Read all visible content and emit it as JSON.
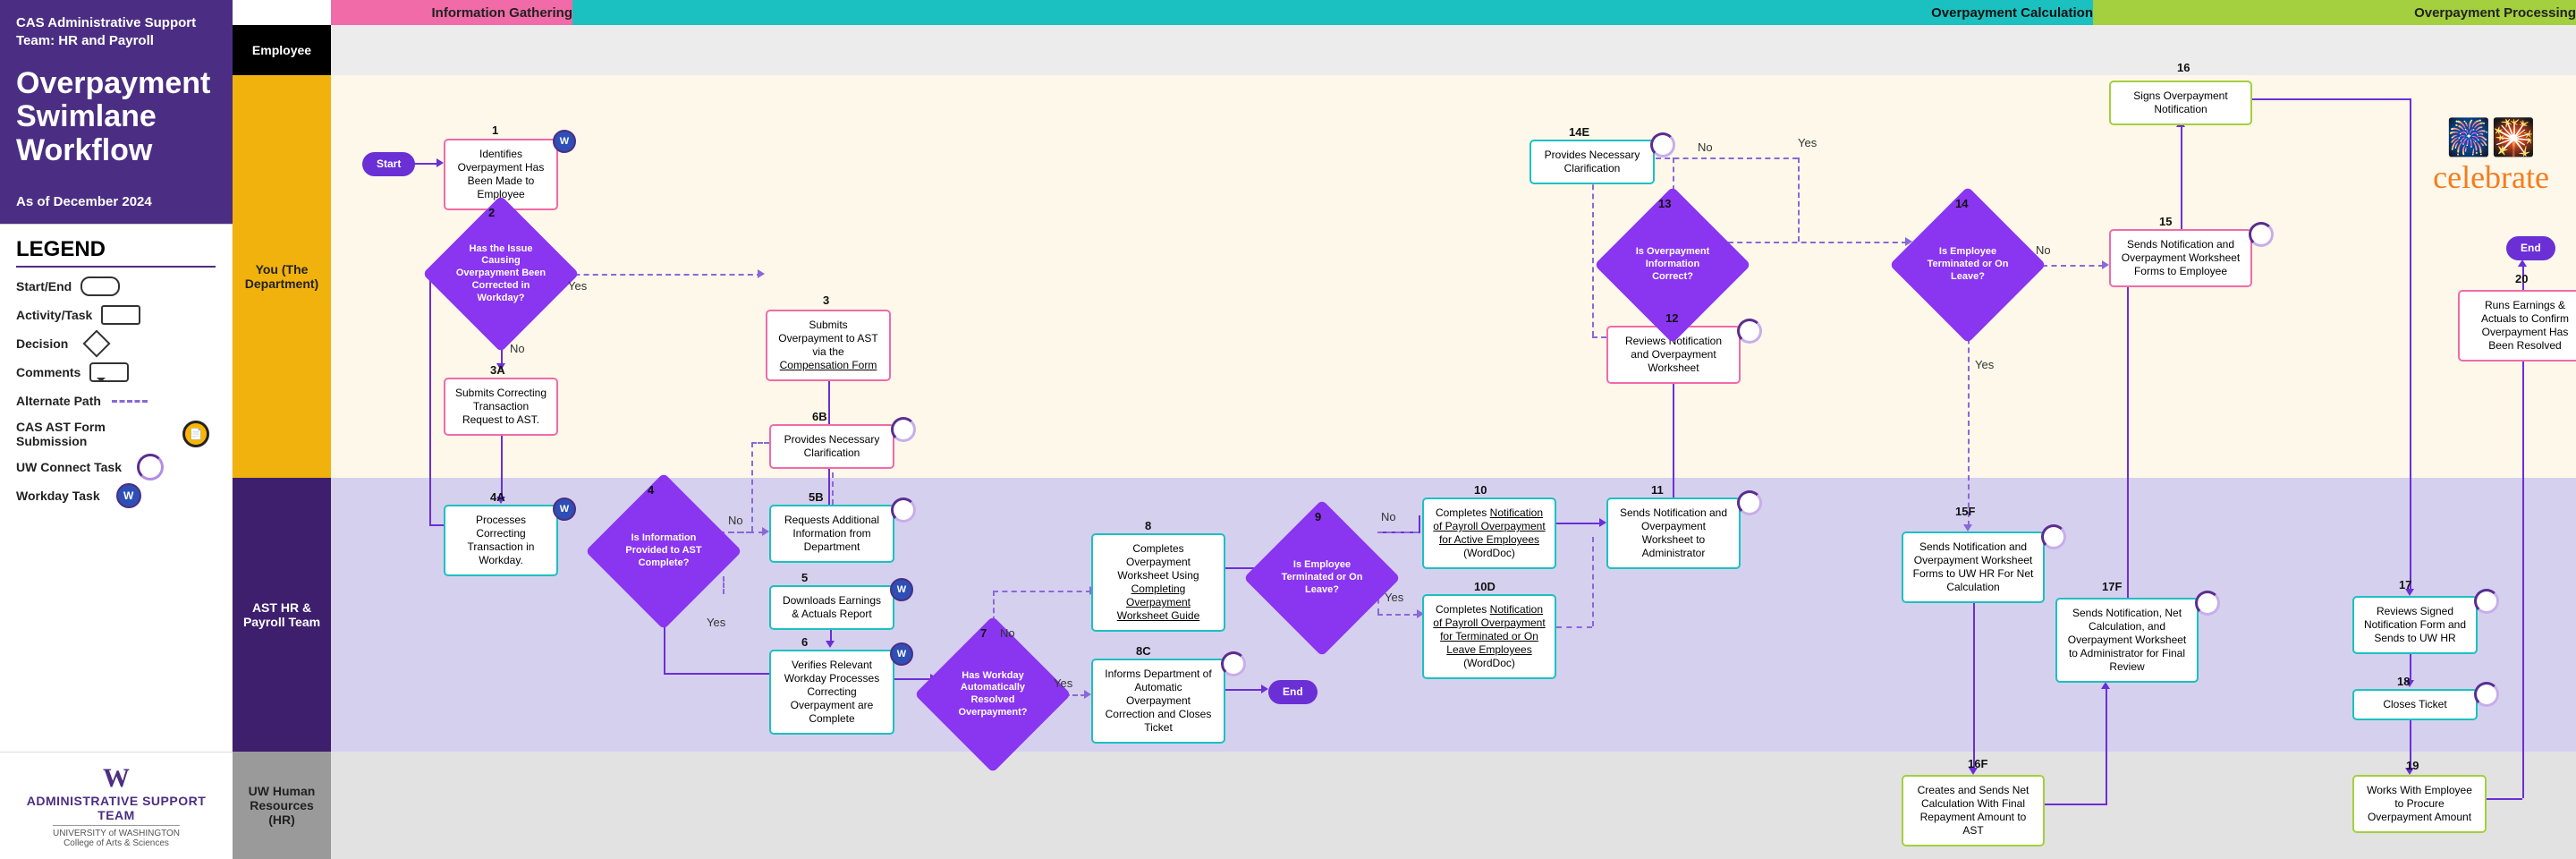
{
  "header": {
    "team": "CAS Administrative Support Team: HR and Payroll",
    "title": "Overpayment Swimlane Workflow",
    "date": "As of December 2024"
  },
  "legend": {
    "title": "LEGEND",
    "items": {
      "startend": "Start/End",
      "task": "Activity/Task",
      "decision": "Decision",
      "comments": "Comments",
      "altpath": "Alternate Path",
      "casform": "CAS AST Form Submission",
      "uwconnect": "UW Connect Task",
      "workday": "Workday Task"
    }
  },
  "footer": {
    "big": "ADMINISTRATIVE SUPPORT TEAM",
    "line2": "UNIVERSITY of WASHINGTON",
    "line3": "College of Arts & Sciences"
  },
  "phases": {
    "p1": "Information Gathering",
    "p2": "Overpayment Calculation",
    "p3": "Overpayment Processing"
  },
  "lanes": {
    "emp": "Employee",
    "dept": "You (The Department)",
    "ast": "AST HR & Payroll Team",
    "hr": "UW Human Resources (HR)"
  },
  "steps": {
    "start": "Start",
    "n1": "Identifies Overpayment Has Been Made to Employee",
    "n2": "Has the Issue Causing Overpayment Been Corrected in Workday?",
    "n3": "Submits Overpayment to AST via the ",
    "n3_link": "Compensation Form",
    "n3a": "Submits Correcting Transaction Request to AST.",
    "n4a": "Processes Correcting Transaction in Workday.",
    "n4": "Is Information Provided to AST Complete?",
    "n5b": "Requests Additional Information from Department",
    "n6b": "Provides Necessary Clarification",
    "n5": "Downloads Earnings & Actuals Report",
    "n6": "Verifies Relevant Workday Processes Correcting Overpayment are Complete",
    "n7": "Has Workday Automatically Resolved Overpayment?",
    "n8c": "Informs Department of Automatic Overpayment Correction and Closes Ticket",
    "n8": "Completes Overpayment Worksheet Using ",
    "n8_link": "Completing Overpayment Worksheet Guide",
    "n9": "Is Employee Terminated or On Leave?",
    "n10": "Completes ",
    "n10_link": "Notification of Payroll Overpayment for Active Employees",
    "n10_suf": " (WordDoc)",
    "n10d": "Completes ",
    "n10d_link": "Notification of Payroll Overpayment for Terminated or On Leave Employees",
    "n10d_suf": " (WordDoc)",
    "n11": "Sends Notification and Overpayment Worksheet to Administrator",
    "n12": "Reviews Notification and Overpayment Worksheet",
    "n13": "Is Overpayment Information Correct?",
    "n14e": "Provides Necessary Clarification",
    "n14": "Is Employee Terminated or On Leave?",
    "n15": "Sends Notification and Overpayment Worksheet Forms to Employee",
    "n15f": "Sends Notification and Overpayment Worksheet Forms to UW HR For Net Calculation",
    "n16": "Signs Overpayment Notification",
    "n16f": "Creates and Sends Net Calculation With Final Repayment Amount to AST",
    "n17": "Reviews Signed Notification Form and Sends to UW HR",
    "n17f": "Sends Notification, Net Calculation, and Overpayment Worksheet to Administrator for Final Review",
    "n18": "Closes Ticket",
    "n19": "Works With Employee to Procure Overpayment Amount",
    "n20": "Runs Earnings & Actuals to Confirm Overpayment Has Been Resolved",
    "end": "End",
    "end2": "End"
  },
  "labels": {
    "yes": "Yes",
    "no": "No",
    "celebrate": "celebrate"
  },
  "nums": {
    "n1": "1",
    "n2": "2",
    "n3": "3",
    "n3a": "3A",
    "n4a": "4A",
    "n4": "4",
    "n5b": "5B",
    "n6b": "6B",
    "n5": "5",
    "n6": "6",
    "n7": "7",
    "n8c": "8C",
    "n8": "8",
    "n9": "9",
    "n10": "10",
    "n10d": "10D",
    "n11": "11",
    "n12": "12",
    "n13": "13",
    "n14e": "14E",
    "n14": "14",
    "n15": "15",
    "n15f": "15F",
    "n16": "16",
    "n16f": "16F",
    "n17": "17",
    "n17f": "17F",
    "n18": "18",
    "n19": "19",
    "n20": "20"
  }
}
